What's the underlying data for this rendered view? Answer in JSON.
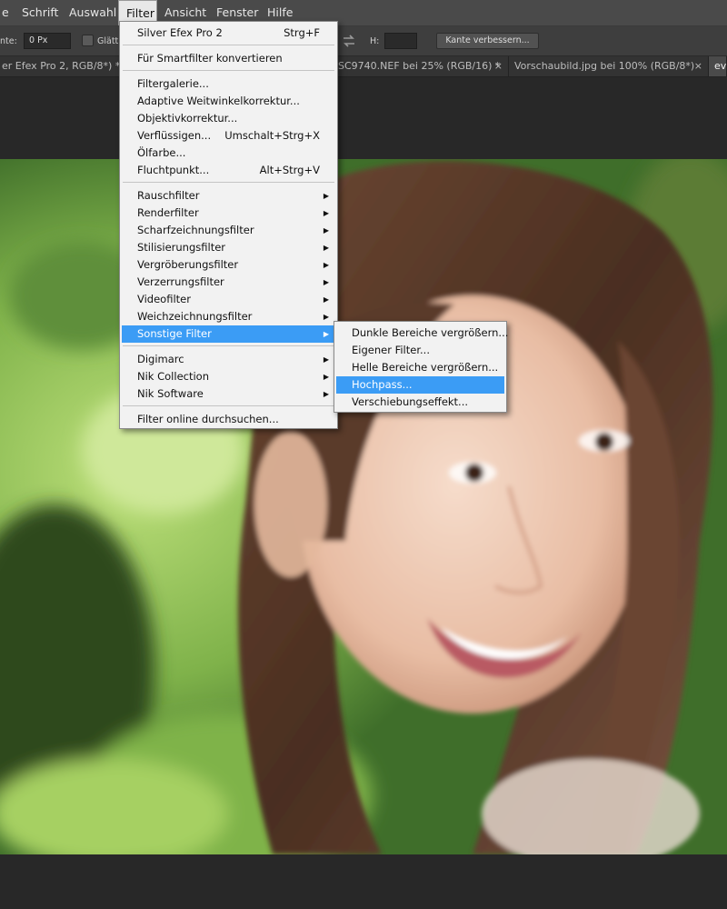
{
  "menubar": {
    "items": [
      "e",
      "Schrift",
      "Auswahl",
      "Filter",
      "Ansicht",
      "Fenster",
      "Hilfe"
    ],
    "active": "Filter"
  },
  "options": {
    "feather_label": "nte:",
    "feather_value": "0 Px",
    "smooth_label": "Glätt",
    "height_label": "H:",
    "refine_edge_button": "Kante verbessern..."
  },
  "tabs": [
    {
      "label": "er Efex Pro 2, RGB/8*) *",
      "close": "×"
    },
    {
      "label": "SC9740.NEF bei 25% (RGB/16) *",
      "close": "×"
    },
    {
      "label": "Vorschaubild.jpg bei 100% (RGB/8*)",
      "close": "×"
    },
    {
      "label": "ev",
      "close": ""
    }
  ],
  "filter_menu": {
    "items": [
      {
        "label": "Silver Efex Pro 2",
        "shortcut": "Strg+F"
      },
      {
        "label": "Für Smartfilter konvertieren"
      },
      {
        "label": "Filtergalerie..."
      },
      {
        "label": "Adaptive Weitwinkelkorrektur..."
      },
      {
        "label": "Objektivkorrektur..."
      },
      {
        "label": "Verflüssigen...",
        "shortcut": "Umschalt+Strg+X"
      },
      {
        "label": "Ölfarbe..."
      },
      {
        "label": "Fluchtpunkt...",
        "shortcut": "Alt+Strg+V"
      },
      {
        "label": "Rauschfilter",
        "submenu": true
      },
      {
        "label": "Renderfilter",
        "submenu": true
      },
      {
        "label": "Scharfzeichnungsfilter",
        "submenu": true
      },
      {
        "label": "Stilisierungsfilter",
        "submenu": true
      },
      {
        "label": "Vergröberungsfilter",
        "submenu": true
      },
      {
        "label": "Verzerrungsfilter",
        "submenu": true
      },
      {
        "label": "Videofilter",
        "submenu": true
      },
      {
        "label": "Weichzeichnungsfilter",
        "submenu": true
      },
      {
        "label": "Sonstige Filter",
        "submenu": true,
        "highlighted": true
      },
      {
        "label": "Digimarc",
        "submenu": true
      },
      {
        "label": "Nik Collection",
        "submenu": true
      },
      {
        "label": "Nik Software",
        "submenu": true
      },
      {
        "label": "Filter online durchsuchen..."
      }
    ],
    "submenu_arrow": "▶"
  },
  "submenu": {
    "items": [
      {
        "label": "Dunkle Bereiche vergrößern..."
      },
      {
        "label": "Eigener Filter..."
      },
      {
        "label": "Helle Bereiche vergrößern..."
      },
      {
        "label": "Hochpass...",
        "highlighted": true
      },
      {
        "label": "Verschiebungseffekt..."
      }
    ]
  },
  "colors": {
    "menu_highlight": "#3b9cf5",
    "app_background": "#2b2b2b"
  }
}
